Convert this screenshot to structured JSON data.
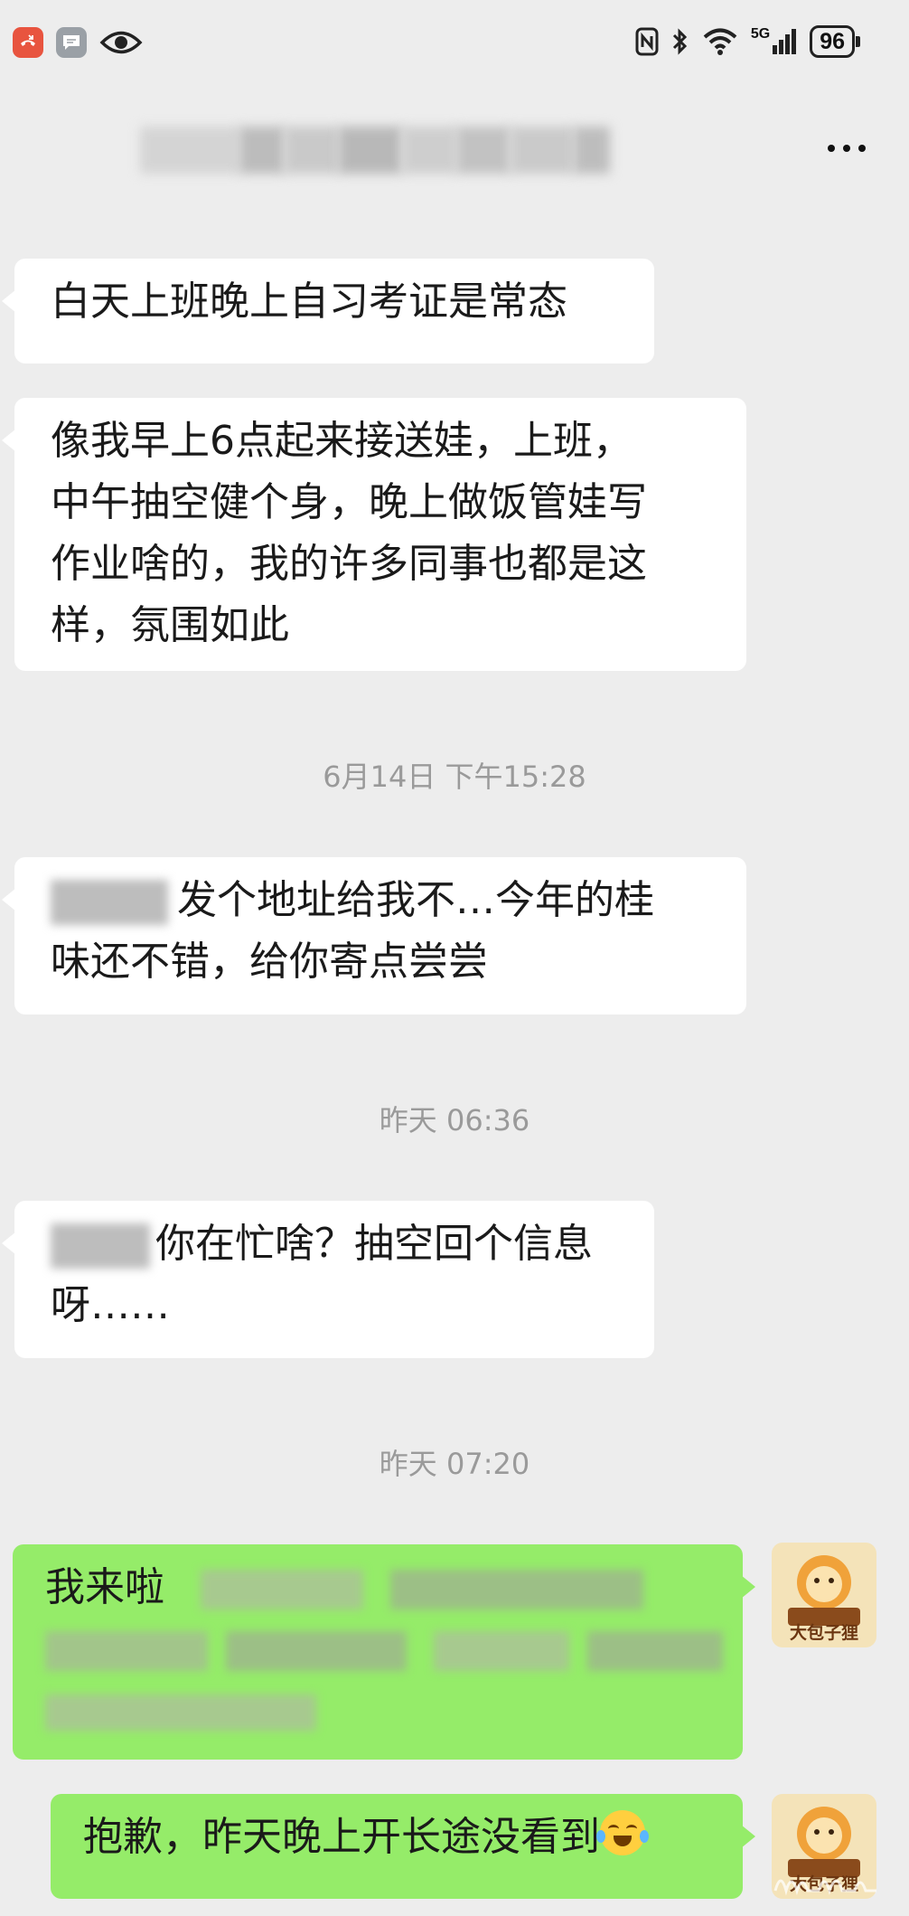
{
  "status_bar": {
    "network": "5G",
    "battery": "96",
    "icons": [
      "missed-call-icon",
      "message-icon",
      "eye-icon",
      "nfc-icon",
      "bluetooth-icon",
      "wifi-icon",
      "signal-icon",
      "battery-icon"
    ]
  },
  "title_bar": {
    "title_blurred": true,
    "more_icon": "more-icon"
  },
  "messages": [
    {
      "side": "left",
      "text": "白天上班晚上自习考证是常态"
    },
    {
      "side": "left",
      "lines": [
        "像我早上6点起来接送娃，上班，",
        "中午抽空健个身，晚上做饭管娃写",
        "作业啥的，我的许多同事也都是这",
        "样，氛围如此"
      ]
    },
    {
      "type": "timestamp",
      "text": "6月14日 下午15:28"
    },
    {
      "side": "left",
      "lines": [
        "发个地址给我不…今年的桂",
        "味还不错，给你寄点尝尝"
      ]
    },
    {
      "type": "timestamp",
      "text": "昨天 06:36"
    },
    {
      "side": "left",
      "lines": [
        "你在忙啥？抽空回个信息",
        "呀……"
      ]
    },
    {
      "type": "timestamp",
      "text": "昨天 07:20"
    },
    {
      "side": "right",
      "text": "我来啦"
    },
    {
      "side": "right",
      "text": "抱歉，昨天晚上开长途没看到"
    }
  ],
  "avatar_text": "大包子狸",
  "colors": {
    "background": "#ededed",
    "bubble_left": "#ffffff",
    "bubble_right": "#95ec69",
    "timestamp": "#9a9a9a"
  }
}
